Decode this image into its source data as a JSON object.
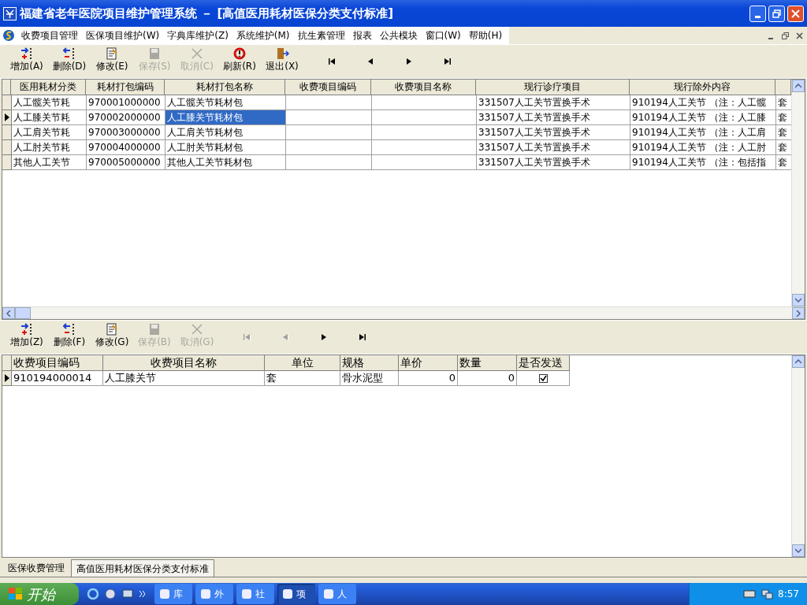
{
  "window": {
    "title": "福建省老年医院项目维护管理系统 － [高值医用耗材医保分类支付标准]"
  },
  "menu": [
    "收费项目管理",
    "医保项目维护(W)",
    "字典库维护(Z)",
    "系统维护(M)",
    "抗生素管理",
    "报表",
    "公共模块",
    "窗口(W)",
    "帮助(H)"
  ],
  "toolbar_top": {
    "buttons": [
      {
        "kind": "add",
        "label": "增加(A)",
        "disabled": false
      },
      {
        "kind": "delete",
        "label": "删除(D)",
        "disabled": false
      },
      {
        "kind": "edit",
        "label": "修改(E)",
        "disabled": false
      },
      {
        "kind": "save",
        "label": "保存(S)",
        "disabled": true
      },
      {
        "kind": "cancel",
        "label": "取消(C)",
        "disabled": true
      },
      {
        "kind": "refresh",
        "label": "刷新(R)",
        "disabled": false
      },
      {
        "kind": "exit",
        "label": "退出(X)",
        "disabled": false
      }
    ],
    "nav": [
      {
        "kind": "first",
        "disabled": false
      },
      {
        "kind": "prev",
        "disabled": false
      },
      {
        "kind": "next",
        "disabled": false
      },
      {
        "kind": "last",
        "disabled": false
      }
    ]
  },
  "grid_top": {
    "columns": [
      "医用耗材分类",
      "耗材打包编码",
      "耗材打包名称",
      "收费项目编码",
      "收费项目名称",
      "现行诊疗项目",
      "现行除外内容"
    ],
    "rows": [
      {
        "selected": false,
        "cells": [
          "人工髋关节耗",
          "970001000000",
          "人工髋关节耗材包",
          "",
          "",
          "331507人工关节置换手术",
          "910194人工关节 （注：人工髋",
          "套"
        ]
      },
      {
        "selected": true,
        "cells": [
          "人工膝关节耗",
          "970002000000",
          "人工膝关节耗材包",
          "",
          "",
          "331507人工关节置换手术",
          "910194人工关节 （注：人工膝",
          "套"
        ]
      },
      {
        "selected": false,
        "cells": [
          "人工肩关节耗",
          "970003000000",
          "人工肩关节耗材包",
          "",
          "",
          "331507人工关节置换手术",
          "910194人工关节 （注：人工肩",
          "套"
        ]
      },
      {
        "selected": false,
        "cells": [
          "人工肘关节耗",
          "970004000000",
          "人工肘关节耗材包",
          "",
          "",
          "331507人工关节置换手术",
          "910194人工关节 （注：人工肘",
          "套"
        ]
      },
      {
        "selected": false,
        "cells": [
          "其他人工关节",
          "970005000000",
          "其他人工关节耗材包",
          "",
          "",
          "331507人工关节置换手术",
          "910194人工关节 （注：包括指",
          "套"
        ]
      }
    ]
  },
  "toolbar_bottom": {
    "buttons": [
      {
        "kind": "add",
        "label": "增加(Z)",
        "disabled": false
      },
      {
        "kind": "delete",
        "label": "删除(F)",
        "disabled": false
      },
      {
        "kind": "edit",
        "label": "修改(G)",
        "disabled": false
      },
      {
        "kind": "save",
        "label": "保存(B)",
        "disabled": true
      },
      {
        "kind": "cancel",
        "label": "取消(G)",
        "disabled": true
      }
    ],
    "nav": [
      {
        "kind": "first",
        "disabled": true
      },
      {
        "kind": "prev",
        "disabled": true
      },
      {
        "kind": "next",
        "disabled": false
      },
      {
        "kind": "last",
        "disabled": false
      }
    ]
  },
  "grid_bottom": {
    "columns": [
      "收费项目编码",
      "收费项目名称",
      "单位",
      "规格",
      "单价",
      "数量",
      "是否发送"
    ],
    "rows": [
      {
        "selected": true,
        "code": "910194000014",
        "name": "人工膝关节",
        "unit": "套",
        "spec": "骨水泥型",
        "price": "0",
        "qty": "0",
        "sent": true
      }
    ]
  },
  "tabs": [
    {
      "label": "医保收费管理",
      "selected": false
    },
    {
      "label": "高值医用耗材医保分类支付标准",
      "selected": true
    }
  ],
  "taskbar": {
    "start": "开始",
    "items": [
      {
        "label": "库",
        "selected": false
      },
      {
        "label": "外",
        "selected": false
      },
      {
        "label": "社",
        "selected": false
      },
      {
        "label": "项",
        "selected": true
      },
      {
        "label": "人",
        "selected": false
      }
    ],
    "clock": "8:57"
  }
}
